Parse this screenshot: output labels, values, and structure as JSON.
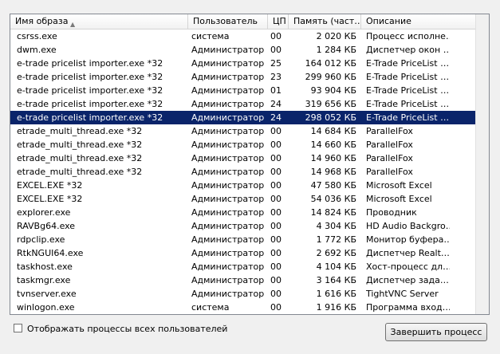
{
  "header": {
    "columns": [
      "Имя образа",
      "Пользователь",
      "ЦП",
      "Память (част…",
      "Описание"
    ]
  },
  "rows": [
    {
      "name": "csrss.exe",
      "user": "система",
      "cpu": "00",
      "mem": "2 020 КБ",
      "desc": "Процесс исполне…"
    },
    {
      "name": "dwm.exe",
      "user": "Администратор",
      "cpu": "00",
      "mem": "1 284 КБ",
      "desc": "Диспетчер окон …"
    },
    {
      "name": "e-trade pricelist importer.exe *32",
      "user": "Администратор",
      "cpu": "25",
      "mem": "164 012 КБ",
      "desc": "E-Trade PriceList …"
    },
    {
      "name": "e-trade pricelist importer.exe *32",
      "user": "Администратор",
      "cpu": "23",
      "mem": "299 960 КБ",
      "desc": "E-Trade PriceList …"
    },
    {
      "name": "e-trade pricelist importer.exe *32",
      "user": "Администратор",
      "cpu": "01",
      "mem": "93 904 КБ",
      "desc": "E-Trade PriceList …"
    },
    {
      "name": "e-trade pricelist importer.exe *32",
      "user": "Администратор",
      "cpu": "24",
      "mem": "319 656 КБ",
      "desc": "E-Trade PriceList …"
    },
    {
      "name": "e-trade pricelist importer.exe *32",
      "user": "Администратор",
      "cpu": "24",
      "mem": "298 052 КБ",
      "desc": "E-Trade PriceList …",
      "selected": true
    },
    {
      "name": "etrade_multi_thread.exe *32",
      "user": "Администратор",
      "cpu": "00",
      "mem": "14 684 КБ",
      "desc": "ParallelFox"
    },
    {
      "name": "etrade_multi_thread.exe *32",
      "user": "Администратор",
      "cpu": "00",
      "mem": "14 660 КБ",
      "desc": "ParallelFox"
    },
    {
      "name": "etrade_multi_thread.exe *32",
      "user": "Администратор",
      "cpu": "00",
      "mem": "14 960 КБ",
      "desc": "ParallelFox"
    },
    {
      "name": "etrade_multi_thread.exe *32",
      "user": "Администратор",
      "cpu": "00",
      "mem": "14 968 КБ",
      "desc": "ParallelFox"
    },
    {
      "name": "EXCEL.EXE *32",
      "user": "Администратор",
      "cpu": "00",
      "mem": "47 580 КБ",
      "desc": "Microsoft Excel"
    },
    {
      "name": "EXCEL.EXE *32",
      "user": "Администратор",
      "cpu": "00",
      "mem": "54 036 КБ",
      "desc": "Microsoft Excel"
    },
    {
      "name": "explorer.exe",
      "user": "Администратор",
      "cpu": "00",
      "mem": "14 824 КБ",
      "desc": "Проводник"
    },
    {
      "name": "RAVBg64.exe",
      "user": "Администратор",
      "cpu": "00",
      "mem": "4 304 КБ",
      "desc": "HD Audio Backgro…"
    },
    {
      "name": "rdpclip.exe",
      "user": "Администратор",
      "cpu": "00",
      "mem": "1 772 КБ",
      "desc": "Монитор буфера…"
    },
    {
      "name": "RtkNGUI64.exe",
      "user": "Администратор",
      "cpu": "00",
      "mem": "2 692 КБ",
      "desc": "Диспетчер Realt…"
    },
    {
      "name": "taskhost.exe",
      "user": "Администратор",
      "cpu": "00",
      "mem": "4 104 КБ",
      "desc": "Хост-процесс дл…"
    },
    {
      "name": "taskmgr.exe",
      "user": "Администратор",
      "cpu": "00",
      "mem": "3 164 КБ",
      "desc": "Диспетчер зада…"
    },
    {
      "name": "tvnserver.exe",
      "user": "Администратор",
      "cpu": "00",
      "mem": "1 616 КБ",
      "desc": "TightVNC Server"
    },
    {
      "name": "winlogon.exe",
      "user": "система",
      "cpu": "00",
      "mem": "1 916 КБ",
      "desc": "Программа вход…"
    }
  ],
  "footer": {
    "show_all_label": "Отображать процессы всех пользователей",
    "end_process_label": "Завершить процесс"
  }
}
